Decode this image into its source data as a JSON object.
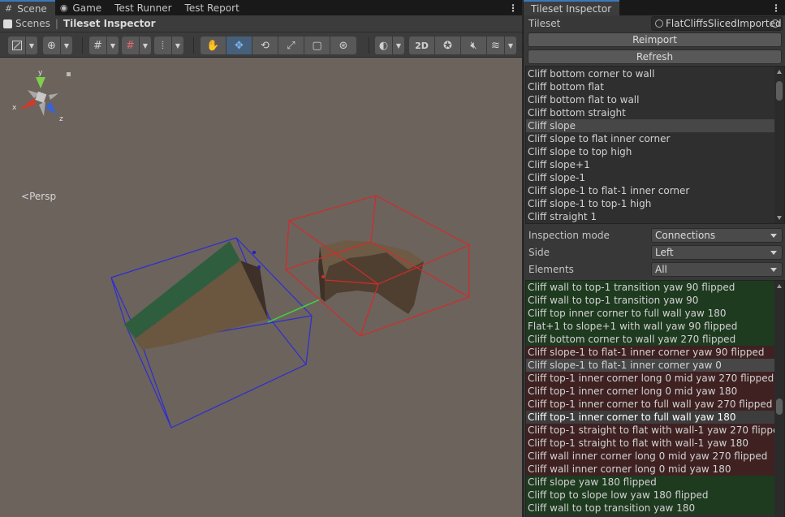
{
  "left_tabs": [
    {
      "label": "Scene",
      "icon": "hash-grid-icon",
      "active": true
    },
    {
      "label": "Game",
      "icon": "gamepad-icon",
      "active": false
    },
    {
      "label": "Test Runner",
      "icon": "",
      "active": false
    },
    {
      "label": "Test Report",
      "icon": "",
      "active": false
    }
  ],
  "breadcrumb": {
    "root": "Scenes",
    "current": "Tileset Inspector"
  },
  "toolbar": {
    "view_2d": "2D"
  },
  "scene": {
    "persp_label": "Persp",
    "axis_labels": {
      "y": "y",
      "x": "x",
      "z": "z"
    }
  },
  "inspector": {
    "tab_label": "Tileset Inspector",
    "tileset_label": "Tileset",
    "tileset_value": "FlatCliffsSlicedImported",
    "reimport_label": "Reimport",
    "refresh_label": "Refresh",
    "tile_list": [
      "Cliff bottom corner to wall",
      "Cliff bottom flat",
      "Cliff bottom flat to wall",
      "Cliff bottom straight",
      "Cliff slope",
      "Cliff slope to flat inner corner",
      "Cliff slope to top high",
      "Cliff slope+1",
      "Cliff slope-1",
      "Cliff slope-1 to flat-1 inner corner",
      "Cliff slope-1 to top-1 high",
      "Cliff straight 1"
    ],
    "tile_selected_index": 4,
    "mode_label": "Inspection mode",
    "mode_value": "Connections",
    "side_label": "Side",
    "side_value": "Left",
    "elements_label": "Elements",
    "elements_value": "All",
    "connections": [
      {
        "label": "Cliff wall to top-1 transition yaw 90 flipped",
        "status": "green"
      },
      {
        "label": "Cliff wall to top-1 transition yaw 90",
        "status": "green"
      },
      {
        "label": "Cliff top inner corner to full wall yaw 180",
        "status": "green"
      },
      {
        "label": "Flat+1 to slope+1 with wall yaw 90 flipped",
        "status": "green"
      },
      {
        "label": "Cliff bottom corner to wall yaw 270 flipped",
        "status": "green"
      },
      {
        "label": "Cliff slope-1 to flat-1 inner corner yaw 90 flipped",
        "status": "red"
      },
      {
        "label": "Cliff slope-1 to flat-1 inner corner yaw 0",
        "status": "grey"
      },
      {
        "label": "Cliff top-1 inner corner long 0 mid yaw 270 flipped",
        "status": "red"
      },
      {
        "label": "Cliff top-1 inner corner long 0 mid yaw 180",
        "status": "red"
      },
      {
        "label": "Cliff top-1 inner corner to full wall yaw 270 flipped",
        "status": "red"
      },
      {
        "label": "Cliff top-1 inner corner to full wall yaw 180",
        "status": "selected"
      },
      {
        "label": "Cliff top-1 straight to flat with wall-1 yaw 270 flipped",
        "status": "red"
      },
      {
        "label": "Cliff top-1 straight to flat with wall-1 yaw 180",
        "status": "red"
      },
      {
        "label": "Cliff wall inner corner long 0 mid yaw 270 flipped",
        "status": "red"
      },
      {
        "label": "Cliff wall inner corner long 0 mid yaw 180",
        "status": "red"
      },
      {
        "label": "Cliff slope yaw 180 flipped",
        "status": "green"
      },
      {
        "label": "Cliff top to slope low yaw 180 flipped",
        "status": "green"
      },
      {
        "label": "Cliff wall to top transition yaw 180",
        "status": "green"
      }
    ]
  },
  "colors": {
    "accent": "#3a79bb",
    "green_row": "#1e3a1f",
    "red_row": "#3f2121",
    "scene_bg": "#6c635c"
  }
}
